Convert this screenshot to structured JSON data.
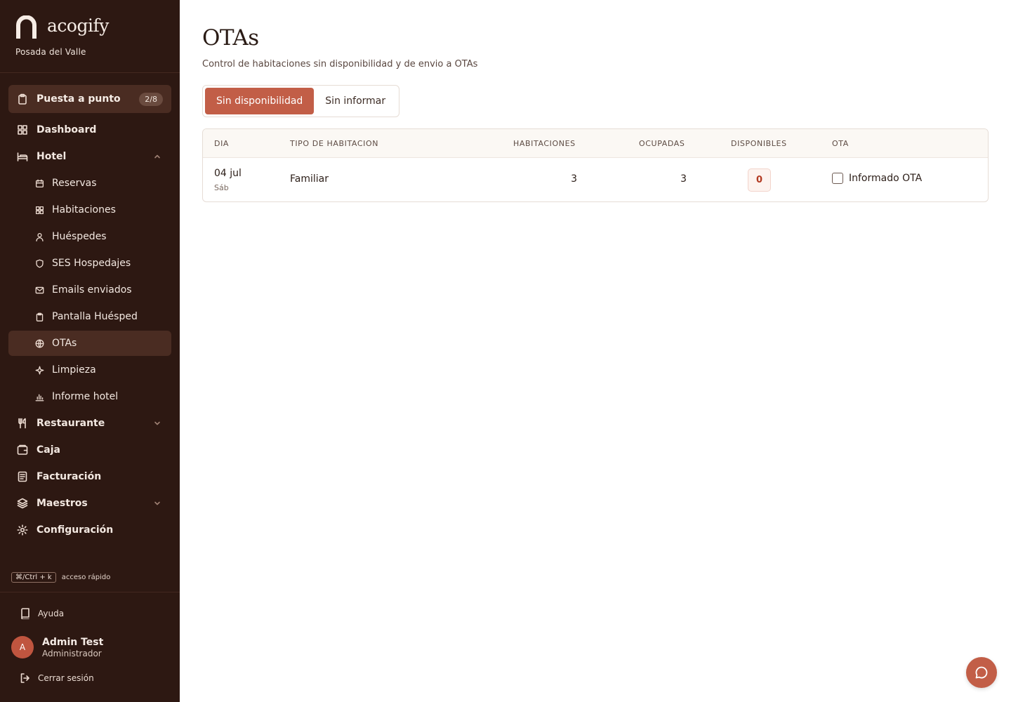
{
  "brand": {
    "name": "acogify",
    "hotel": "Posada del Valle"
  },
  "setup": {
    "label": "Puesta a punto",
    "badge": "2/8"
  },
  "nav": {
    "dashboard": "Dashboard",
    "hotel": "Hotel",
    "hotel_items": [
      "Reservas",
      "Habitaciones",
      "Huéspedes",
      "SES Hospedajes",
      "Emails enviados",
      "Pantalla Huésped",
      "OTAs",
      "Limpieza",
      "Informe hotel"
    ],
    "restaurante": "Restaurante",
    "caja": "Caja",
    "facturacion": "Facturación",
    "maestros": "Maestros",
    "configuracion": "Configuración"
  },
  "shortcut": {
    "key": "⌘/Ctrl + k",
    "label": "acceso rápido"
  },
  "footer": {
    "help": "Ayuda",
    "user_initial": "A",
    "user_name": "Admin Test",
    "user_role": "Administrador",
    "logout": "Cerrar sesión"
  },
  "page": {
    "title": "OTAs",
    "subtitle": "Control de habitaciones sin disponibilidad y de envio a OTAs",
    "tabs": [
      "Sin disponibilidad",
      "Sin informar"
    ],
    "active_tab": "Sin disponibilidad"
  },
  "table": {
    "columns": [
      "DIA",
      "TIPO DE HABITACION",
      "HABITACIONES",
      "OCUPADAS",
      "DISPONIBLES",
      "OTA"
    ],
    "rows": [
      {
        "day": "04 jul",
        "weekday": "Sáb",
        "type": "Familiar",
        "rooms": "3",
        "occupied": "3",
        "available": "0",
        "ota_label": "Informado OTA",
        "ota_checked": false
      }
    ]
  },
  "colors": {
    "sidebar": "#2d1812",
    "accent": "#c25e47",
    "active_item": "#4a2c22"
  }
}
